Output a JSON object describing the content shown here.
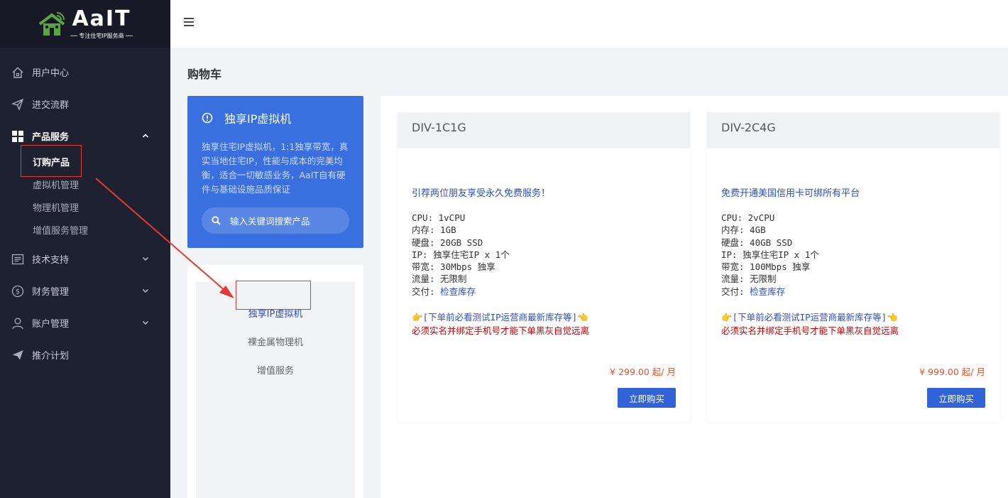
{
  "brand": {
    "name": "AaIT",
    "tagline": "专注住宅IP服务商"
  },
  "sidebar": {
    "items": [
      {
        "label": "用户中心",
        "icon": "home-icon"
      },
      {
        "label": "进交流群",
        "icon": "send-icon"
      },
      {
        "label": "产品服务",
        "icon": "grid-icon",
        "expanded": true,
        "children": [
          "订购产品",
          "虚拟机管理",
          "物理机管理",
          "增值服务管理"
        ]
      },
      {
        "label": "技术支持",
        "icon": "list-icon"
      },
      {
        "label": "财务管理",
        "icon": "dollar-icon"
      },
      {
        "label": "账户管理",
        "icon": "user-icon"
      },
      {
        "label": "推介计划",
        "icon": "send-icon"
      }
    ]
  },
  "page": {
    "title": "购物车"
  },
  "hero": {
    "title": "独享IP虚拟机",
    "description": "独享住宅IP虚拟机，1:1独享带宽，真实当地住宅IP，性能与成本的完美均衡，适合一切敏感业务，AaIT自有硬件与基础设施品质保证",
    "search_placeholder": "输入关键词搜索产品"
  },
  "categories": [
    "独享IP虚拟机",
    "裸金属物理机",
    "增值服务"
  ],
  "products": [
    {
      "name": "DIV-1C1G",
      "promo": "引荐两位朋友享受永久免费服务！",
      "specs": {
        "cpu": "CPU: 1vCPU",
        "mem": "内存: 1GB",
        "disk": "硬盘: 20GB SSD",
        "ip": "IP: 独享住宅IP x 1个",
        "bw": "带宽: 30Mbps 独享",
        "traffic": "流量: 无限制",
        "delivery_label": "交付: ",
        "delivery_link": "检查库存"
      },
      "notice1": "[下单前必看测试IP运营商最新库存等]",
      "notice2": "必须实名并绑定手机号才能下单黑灰自觉远离",
      "price": "¥ 299.00 起/ 月",
      "buy": "立即购买"
    },
    {
      "name": "DIV-2C4G",
      "promo": "免费开通美国信用卡可绑所有平台",
      "specs": {
        "cpu": "CPU: 2vCPU",
        "mem": "内存: 4GB",
        "disk": "硬盘: 40GB SSD",
        "ip": "IP: 独享住宅IP x 1个",
        "bw": "带宽: 100Mbps 独享",
        "traffic": "流量: 无限制",
        "delivery_label": "交付: ",
        "delivery_link": "检查库存"
      },
      "notice1": "[下单前必看测试IP运营商最新库存等]",
      "notice2": "必须实名并绑定手机号才能下单黑灰自觉远离",
      "price": "¥ 999.00 起/ 月",
      "buy": "立即购买"
    }
  ],
  "colors": {
    "accent": "#3a6fe0",
    "sidebar": "#1e2130",
    "annotation": "#e53935",
    "price": "#e4572e"
  }
}
